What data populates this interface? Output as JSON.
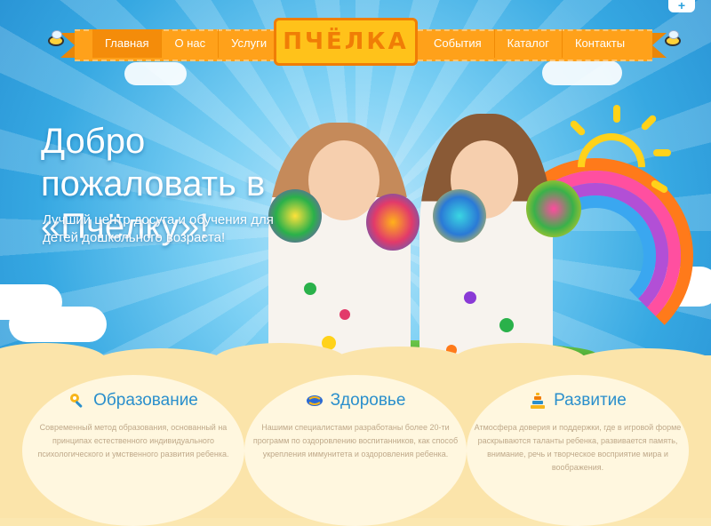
{
  "nav": {
    "left": [
      {
        "label": "Главная",
        "active": true
      },
      {
        "label": "О нас",
        "active": false
      },
      {
        "label": "Услуги",
        "active": false
      }
    ],
    "right": [
      {
        "label": "События",
        "active": false
      },
      {
        "label": "Каталог",
        "active": false
      },
      {
        "label": "Контакты",
        "active": false
      }
    ]
  },
  "logo": {
    "text": "ПЧЁЛКА"
  },
  "hero": {
    "welcome": "Добро пожаловать в «Пчёлку»!",
    "tagline": "Лучший центр досуга и обучения для детей дошкольного возраста!",
    "expand_symbol": "+"
  },
  "features": [
    {
      "icon": "rattle-icon",
      "title": "Образование",
      "text": "Современный метод образования, основанный на принципах естественного индивидуального психологического и умственного развития ребенка."
    },
    {
      "icon": "ball-icon",
      "title": "Здоровье",
      "text": "Нашими специалистами разработаны более 20-ти программ по оздоровлению воспитанников, как способ укрепления иммунитета и оздоровления ребенка."
    },
    {
      "icon": "pyramid-icon",
      "title": "Развитие",
      "text": "Атмосфера доверия и поддержки, где в игровой форме раскрываются таланты ребенка, развивается память, внимание, речь и творческое восприятие мира и воображения."
    }
  ],
  "colors": {
    "accent": "#ffa11a",
    "accent_dark": "#f07d06",
    "sky": "#36a8e2",
    "title_blue": "#2a8fcc",
    "cream": "#fbe4aa"
  }
}
